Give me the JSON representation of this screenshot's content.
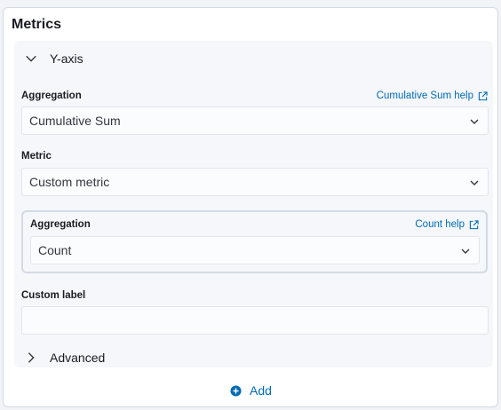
{
  "metrics": {
    "title": "Metrics",
    "yaxis": {
      "accordion_label": "Y-axis",
      "aggregation": {
        "label": "Aggregation",
        "help_link": "Cumulative Sum help",
        "selected": "Cumulative Sum"
      },
      "metric": {
        "label": "Metric",
        "selected": "Custom metric"
      },
      "custom_metric": {
        "aggregation_label": "Aggregation",
        "help_link": "Count help",
        "selected": "Count"
      },
      "custom_label": {
        "label": "Custom label",
        "value": ""
      },
      "advanced_label": "Advanced"
    },
    "add_label": "Add"
  },
  "colors": {
    "link": "#006bb4",
    "text": "#1a1c21",
    "section_bg": "#f5f7fa",
    "border": "#d3dae6"
  }
}
